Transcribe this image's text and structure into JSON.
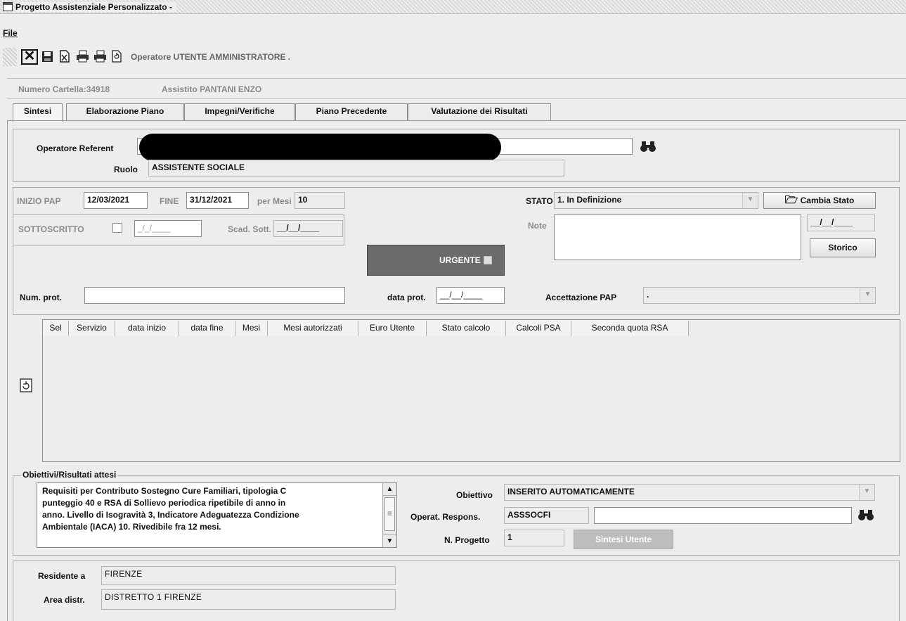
{
  "window": {
    "title": "Progetto Assistenziale Personalizzato  -"
  },
  "menu": {
    "file": "File"
  },
  "toolbar": {
    "operator_label": "Operatore UTENTE AMMINISTRATORE ."
  },
  "header": {
    "cartella": "Numero Cartella:34918",
    "assistito": "Assistito PANTANI ENZO"
  },
  "tabs": [
    {
      "label": "Sintesi"
    },
    {
      "label": "Elaborazione Piano"
    },
    {
      "label": "Impegni/Verifiche"
    },
    {
      "label": "Piano Precedente"
    },
    {
      "label": "Valutazione dei Risultati"
    }
  ],
  "referente": {
    "operatore_label": "Operatore Referent",
    "ruolo_label": "Ruolo",
    "ruolo_value": "ASSISTENTE SOCIALE"
  },
  "pap": {
    "inizio_label": "INIZIO PAP",
    "inizio_value": "12/03/2021",
    "fine_label": "FINE",
    "fine_value": "31/12/2021",
    "mesi_label": "per Mesi",
    "mesi_value": "10",
    "sottoscritto_label": "SOTTOSCRITTO",
    "sottoscritto_date": "_/_/____",
    "scad_label": "Scad. Sott.",
    "scad_value": "__/__/____",
    "urgente_label": "URGENTE",
    "numprot_label": "Num. prot.",
    "numprot_value": "",
    "dataprot_label": "data prot.",
    "dataprot_value": "__/__/____"
  },
  "stato": {
    "label": "STATO",
    "value": "1. In Definizione",
    "cambia_button": "Cambia Stato",
    "note_label": "Note",
    "note_value": "",
    "note_date": "__/__/____",
    "storico_button": "Storico",
    "accettazione_label": "Accettazione PAP",
    "accettazione_value": "."
  },
  "table": {
    "columns": [
      "Sel",
      "Servizio",
      "data inizio",
      "data fine",
      "Mesi",
      "Mesi autorizzati",
      "Euro Utente",
      "Stato calcolo",
      "Calcoli PSA",
      "Seconda quota RSA"
    ],
    "rows": []
  },
  "obiettivi": {
    "group_title": "Obiettivi/Risultati attesi",
    "text_lines": [
      "Requisiti per Contributo Sostegno Cure Familiari, tipologia C",
      "punteggio 40 e RSA di Sollievo periodica ripetibile di anno in",
      "anno. Livello di Isogravità 3, Indicatore Adeguatezza Condizione",
      "Ambientale (IACA) 10. Rivedibile fra 12 mesi."
    ],
    "obiettivo_label": "Obiettivo",
    "obiettivo_value": "INSERITO AUTOMATICAMENTE",
    "operat_label": "Operat. Respons.",
    "operat_code": "ASSSOCFI",
    "operat_name": "",
    "nprogetto_label": "N. Progetto",
    "nprogetto_value": "1",
    "sintesi_button": "Sintesi Utente"
  },
  "residenza": {
    "residente_label": "Residente a",
    "residente_value": "FIRENZE",
    "area_label": "Area distr.",
    "area_value": "DISTRETTO 1 FIRENZE"
  }
}
